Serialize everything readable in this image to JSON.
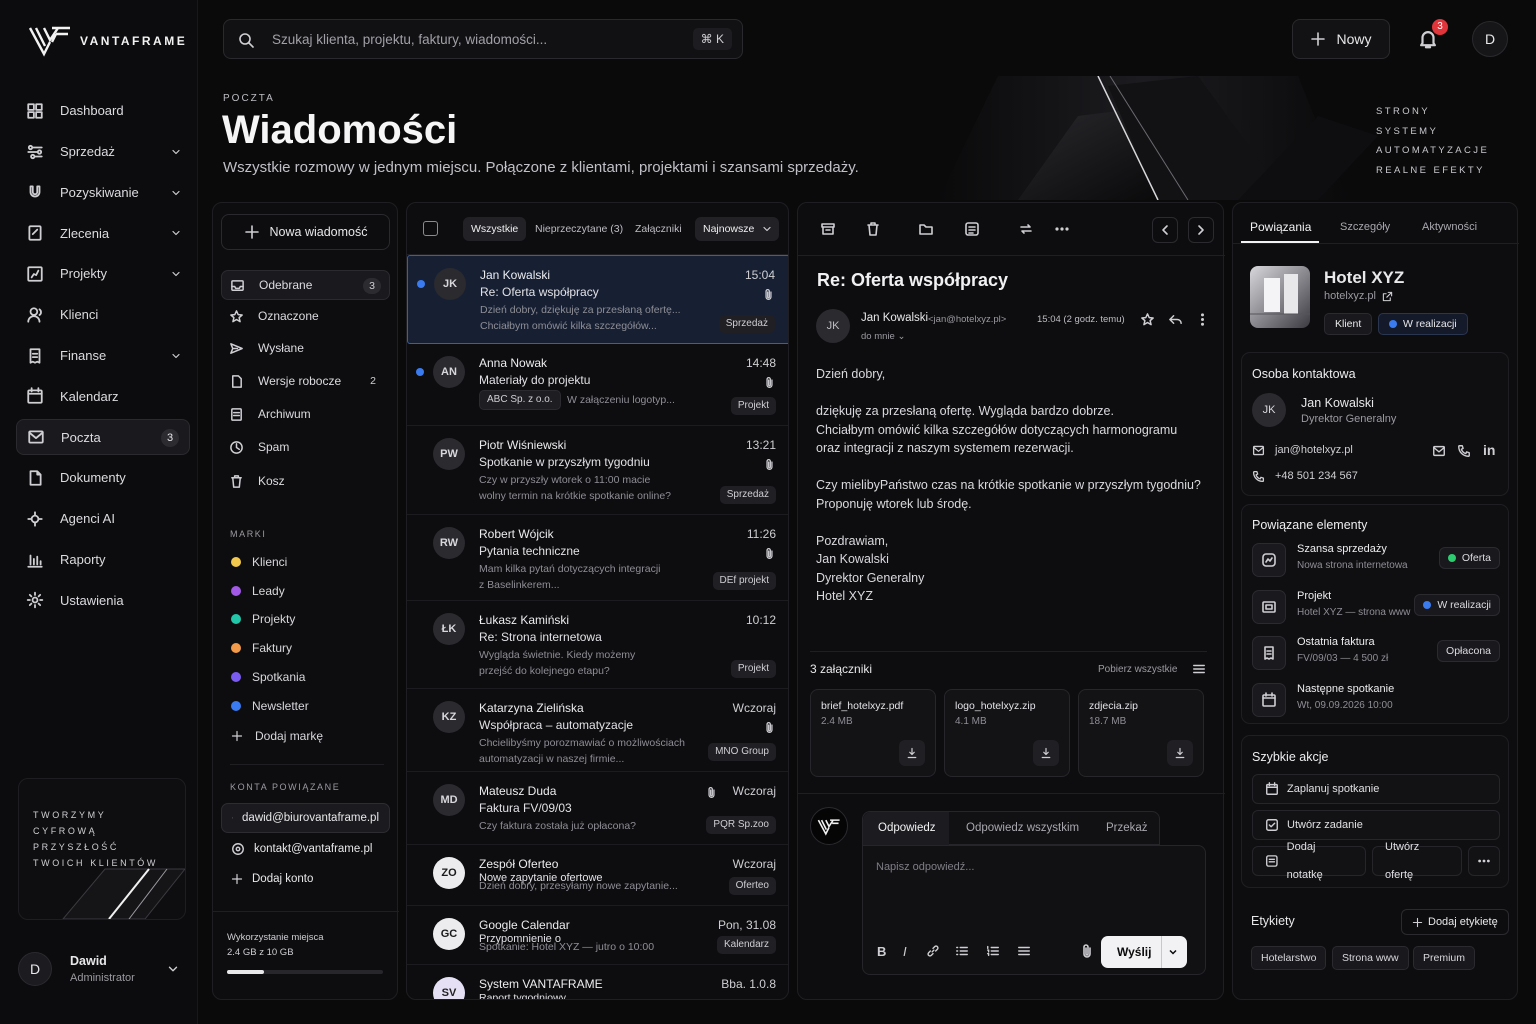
{
  "brand": {
    "name": "VANTAFRAME"
  },
  "nav": [
    {
      "label": "Dashboard",
      "icon": "grid-icon",
      "chevron": false
    },
    {
      "label": "Sprzedaż",
      "icon": "sliders-icon",
      "chevron": true
    },
    {
      "label": "Pozyskiwanie",
      "icon": "magnet-icon",
      "chevron": true
    },
    {
      "label": "Zlecenia",
      "icon": "clipboard-icon",
      "chevron": true
    },
    {
      "label": "Projekty",
      "icon": "chart-square-icon",
      "chevron": true
    },
    {
      "label": "Klienci",
      "icon": "users-icon",
      "chevron": false
    },
    {
      "label": "Finanse",
      "icon": "invoice-icon",
      "chevron": true
    },
    {
      "label": "Kalendarz",
      "icon": "calendar-icon",
      "chevron": false
    },
    {
      "label": "Poczta",
      "icon": "mail-icon",
      "chevron": false,
      "badge": "3",
      "active": true
    },
    {
      "label": "Dokumenty",
      "icon": "document-icon",
      "chevron": false
    },
    {
      "label": "Agenci AI",
      "icon": "ai-agent-icon",
      "chevron": false
    },
    {
      "label": "Raporty",
      "icon": "bar-chart-icon",
      "chevron": false
    },
    {
      "label": "Ustawienia",
      "icon": "gear-icon",
      "chevron": false
    }
  ],
  "promo": {
    "line1": "TWORZYMY",
    "line2": "CYFROWĄ PRZYSZŁOŚĆ",
    "line3": "TWOICH KLIENTÓW"
  },
  "user": {
    "initial": "D",
    "name": "Dawid",
    "role": "Administrator"
  },
  "topbar": {
    "search_placeholder": "Szukaj klienta, projektu, faktury, wiadomości...",
    "shortcut": "⌘ K",
    "new_label": "Nowy",
    "notifications": "3",
    "avatar": "D"
  },
  "hero": {
    "kicker": "POCZTA",
    "title": "Wiadomości",
    "subtitle": "Wszystkie rozmowy w jednym miejscu. Połączone z klientami, projektami i szansami sprzedaży.",
    "taglines": [
      "STRONY",
      "SYSTEMY",
      "AUTOMATYZACJE",
      "REALNE EFEKTY"
    ]
  },
  "mailnav": {
    "compose": "Nowa wiadomość",
    "folders": [
      {
        "label": "Odebrane",
        "count": "3",
        "icon": "inbox-icon",
        "active": true
      },
      {
        "label": "Oznaczone",
        "count": "",
        "icon": "star-icon"
      },
      {
        "label": "Wysłane",
        "count": "",
        "icon": "send-icon"
      },
      {
        "label": "Wersje robocze",
        "count": "2",
        "icon": "draft-icon"
      },
      {
        "label": "Archiwum",
        "count": "",
        "icon": "archive-icon"
      },
      {
        "label": "Spam",
        "count": "",
        "icon": "clock-icon"
      },
      {
        "label": "Kosz",
        "count": "",
        "icon": "trash-icon"
      }
    ],
    "tags_title": "MARKI",
    "tags": [
      {
        "label": "Klienci",
        "color": "#f2c94c"
      },
      {
        "label": "Leady",
        "color": "#a259e6"
      },
      {
        "label": "Projekty",
        "color": "#22c7a9"
      },
      {
        "label": "Faktury",
        "color": "#f2994a"
      },
      {
        "label": "Spotkania",
        "color": "#7b5cf0"
      },
      {
        "label": "Newsletter",
        "color": "#3a7bf0"
      }
    ],
    "add_tag": "Dodaj markę",
    "accounts_title": "KONTA POWIĄZANE",
    "accounts": [
      {
        "email": "dawid@biurovantaframe.pl",
        "active": true
      },
      {
        "email": "kontakt@vantaframe.pl",
        "active": false
      }
    ],
    "add_account": "Dodaj konto",
    "storage_label": "Wykorzystanie miejsca",
    "storage_value": "2.4 GB z 10 GB",
    "storage_used": 0.24
  },
  "list": {
    "filters": [
      "Wszystkie",
      "Nieprzeczytane (3)",
      "Załączniki"
    ],
    "sort": "Najnowsze",
    "mails": [
      {
        "initials": "JK",
        "from": "Jan Kowalski",
        "time": "15:04",
        "subject": "Re: Oferta współpracy",
        "preview1": "Dzień dobry, dziękuję za przesłaną ofertę...",
        "preview2": "Chciałbym omówić kilka szczegółów...",
        "label": "Sprzedaż",
        "unread": true,
        "attach": true,
        "selected": true
      },
      {
        "initials": "AN",
        "from": "Anna Nowak",
        "time": "14:48",
        "subject": "Materiały do projektu",
        "pill": "ABC Sp. z o.o.",
        "preview1": "W załączeniu logotyp...",
        "label": "Projekt",
        "unread": true,
        "attach": true
      },
      {
        "initials": "PW",
        "from": "Piotr Wiśniewski",
        "time": "13:21",
        "subject": "Spotkanie w przyszłym tygodniu",
        "preview1": "Czy w przyszły wtorek o 11:00 macie",
        "preview2": "wolny termin na krótkie spotkanie online?",
        "label": "Sprzedaż",
        "attach": true
      },
      {
        "initials": "RW",
        "from": "Robert Wójcik",
        "time": "11:26",
        "subject": "Pytania techniczne",
        "preview1": "Mam kilka pytań dotyczących integracji",
        "preview2": "z Baselinkerem...",
        "label": "DEf projekt",
        "attach": true
      },
      {
        "initials": "ŁK",
        "from": "Łukasz Kamiński",
        "time": "10:12",
        "subject": "Re: Strona internetowa",
        "preview1": "Wygląda świetnie. Kiedy możemy",
        "preview2": "przejść do kolejnego etapu?",
        "label": "Projekt"
      },
      {
        "initials": "KZ",
        "from": "Katarzyna Zielińska",
        "time": "Wczoraj",
        "subject": "Współpraca – automatyzacje",
        "preview1": "Chcielibyśmy porozmawiać o możliwościach",
        "preview2": "automatyzacji w naszej firmie...",
        "label": "MNO Group",
        "attach": true
      },
      {
        "initials": "MD",
        "from": "Mateusz Duda",
        "time": "Wczoraj",
        "subject": "Faktura FV/09/03",
        "preview1": "Czy faktura została już opłacona?",
        "label": "PQR Sp.zoo",
        "attach": true
      },
      {
        "initials": "ZO",
        "from": "Zespół Oferteo",
        "time": "Wczoraj",
        "subject": "Nowe zapytanie ofertowe",
        "preview1": "Dzień dobry, przesyłamy nowe zapytanie...",
        "label": "Oferteo"
      },
      {
        "initials": "GC",
        "from": "Google Calendar",
        "time": "Pon, 31.08",
        "subject": "Przypomnienie o",
        "preview1": "Spotkanie: Hotel XYZ — jutro o 10:00",
        "label": "Kalendarz"
      },
      {
        "initials": "SV",
        "from": "System VANTAFRAME",
        "time": "Bba. 1.0.8",
        "subject": "Raport tygodniowy"
      }
    ]
  },
  "reader": {
    "subject": "Re: Oferta współpracy",
    "from_name": "Jan Kowalski",
    "from_email": "<jan@hotelxyz.pl>",
    "initials": "JK",
    "to": "do mnie",
    "time": "15:04 (2 godz. temu)",
    "body": [
      "Dzień dobry,",
      "",
      "dziękuję za przesłaną ofertę. Wygląda bardzo dobrze.",
      "Chciałbym omówić kilka szczegółów dotyczących harmonogramu",
      "oraz integracji z naszym systemem rezerwacji.",
      "",
      "Czy mielibyPaństwo czas na krótkie spotkanie w przyszłym tygodniu?",
      "Proponuję wtorek lub środę.",
      "",
      "Pozdrawiam,",
      "Jan Kowalski",
      "Dyrektor Generalny",
      "Hotel XYZ"
    ],
    "attachments_title": "3 załączniki",
    "download_all": "Pobierz wszystkie",
    "attachments": [
      {
        "name": "brief_hotelxyz.pdf",
        "size": "2.4 MB"
      },
      {
        "name": "logo_hotelxyz.zip",
        "size": "4.1 MB"
      },
      {
        "name": "zdjecia.zip",
        "size": "18.7 MB"
      }
    ],
    "reply_tabs": [
      "Odpowiedz",
      "Odpowiedz wszystkim",
      "Przekaż"
    ],
    "reply_placeholder": "Napisz odpowiedź...",
    "send": "Wyślij"
  },
  "details": {
    "tabs": [
      "Powiązania",
      "Szczegóły",
      "Aktywności"
    ],
    "company": {
      "name": "Hotel XYZ",
      "site": "hotelxyz.pl",
      "badge1": "Klient",
      "badge2": "W realizacji"
    },
    "contact_title": "Osoba kontaktowa",
    "contact": {
      "initials": "JK",
      "name": "Jan Kowalski",
      "role": "Dyrektor Generalny",
      "email": "jan@hotelxyz.pl",
      "phone": "+48 501 234 567"
    },
    "related_title": "Powiązane elementy",
    "related": [
      {
        "title": "Szansa sprzedaży",
        "sub": "Nowa strona internetowa",
        "status": "Oferta",
        "dot": "#2ecc71",
        "icon": "opportunity-icon"
      },
      {
        "title": "Projekt",
        "sub": "Hotel XYZ — strona www",
        "status": "W realizacji",
        "dot": "#3a7bf0",
        "icon": "project-icon"
      },
      {
        "title": "Ostatnia faktura",
        "sub": "FV/09/03 — 4 500 zł",
        "status": "Opłacona",
        "dot": "",
        "icon": "invoice-icon"
      },
      {
        "title": "Następne spotkanie",
        "sub": "Wt, 09.09.2026 10:00",
        "status": "",
        "dot": "",
        "icon": "calendar-icon"
      }
    ],
    "quick_title": "Szybkie akcje",
    "quick": [
      "Zaplanuj spotkanie",
      "Utwórz zadanie",
      "Dodaj notatkę",
      "Utwórz ofertę"
    ],
    "labels_title": "Etykiety",
    "add_label": "Dodaj etykietę",
    "labels": [
      "Hotelarstwo",
      "Strona www",
      "Premium"
    ]
  }
}
